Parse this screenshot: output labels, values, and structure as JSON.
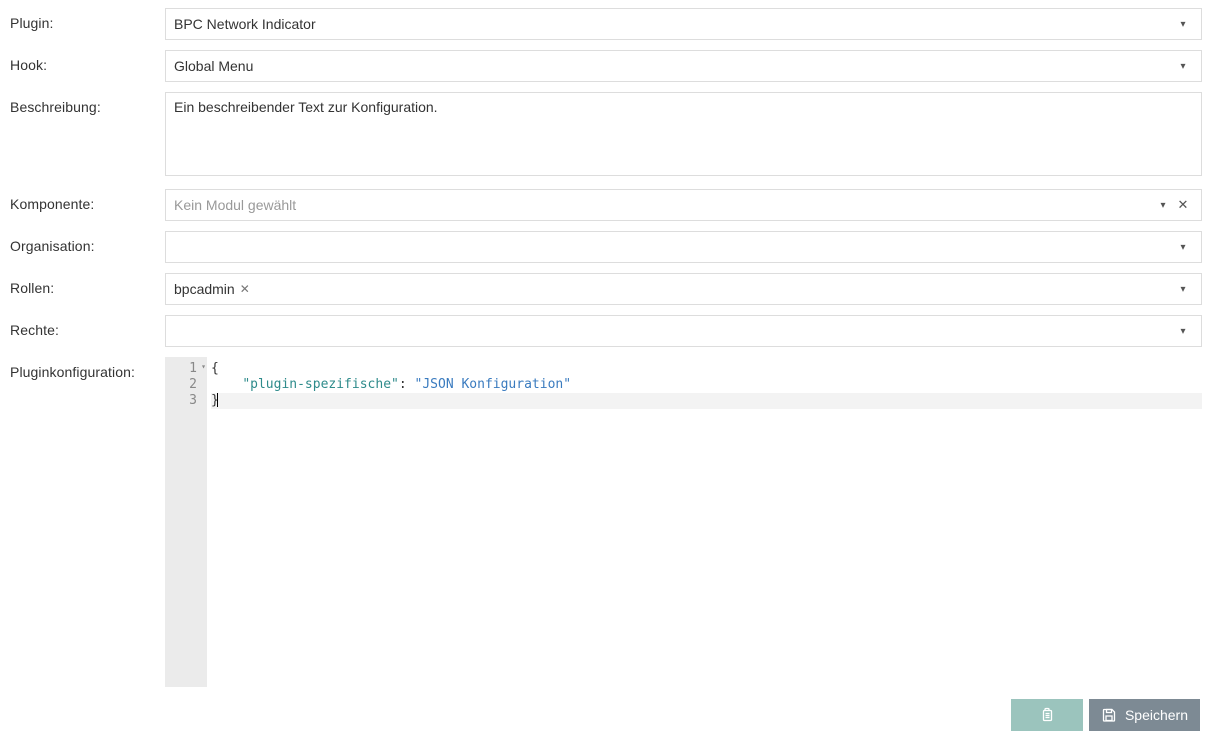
{
  "labels": {
    "plugin": "Plugin:",
    "hook": "Hook:",
    "beschreibung": "Beschreibung:",
    "komponente": "Komponente:",
    "organisation": "Organisation:",
    "rollen": "Rollen:",
    "rechte": "Rechte:",
    "pluginkonfiguration": "Pluginkonfiguration:"
  },
  "values": {
    "plugin": "BPC Network Indicator",
    "hook": "Global Menu",
    "beschreibung": "Ein beschreibender Text zur Konfiguration.",
    "komponente_placeholder": "Kein Modul gewählt",
    "organisation": "",
    "rollen_tag": "bpcadmin",
    "rechte": ""
  },
  "code": {
    "lines": [
      "1",
      "2",
      "3"
    ],
    "l1": "{",
    "l2_indent": "    ",
    "l2_key": "\"plugin-spezifische\"",
    "l2_colon": ": ",
    "l2_val": "\"JSON Konfiguration\"",
    "l3": "}"
  },
  "buttons": {
    "save": "Speichern"
  }
}
